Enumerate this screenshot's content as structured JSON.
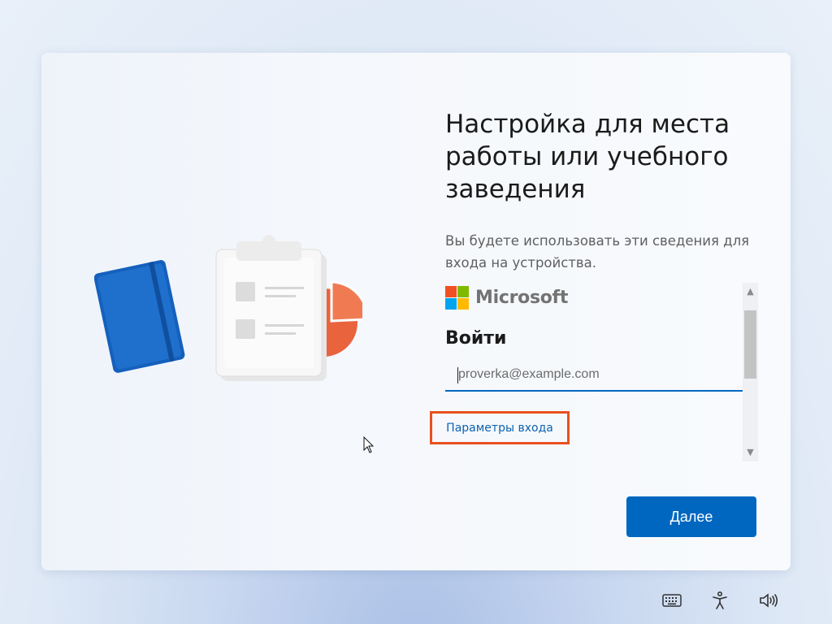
{
  "page": {
    "title": "Настройка для места работы или учебного заведения",
    "subtitle": "Вы будете использовать эти сведения для входа на устройства."
  },
  "microsoft": {
    "brand_name": "Microsoft",
    "logo_colors": [
      "#f25022",
      "#7fba00",
      "#00a4ef",
      "#ffb900"
    ]
  },
  "signin": {
    "heading": "Войти",
    "email_placeholder": "proverka@example.com",
    "options_link": "Параметры входа"
  },
  "actions": {
    "next_label": "Далее"
  },
  "tray": {
    "icons": [
      "keyboard-icon",
      "accessibility-icon",
      "volume-icon"
    ]
  },
  "colors": {
    "accent": "#0067c0",
    "highlight_box": "#e8501f"
  }
}
